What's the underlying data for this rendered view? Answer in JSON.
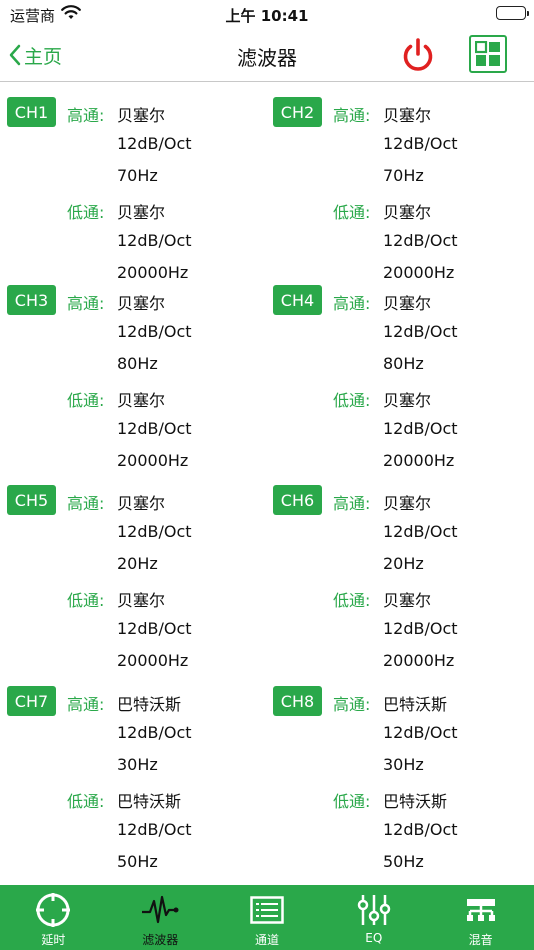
{
  "status": {
    "carrier": "运营商",
    "time": "上午 10:41"
  },
  "nav": {
    "back_label": "主页",
    "title": "滤波器"
  },
  "labels": {
    "high": "高通:",
    "low": "低通:"
  },
  "channels": [
    {
      "name": "CH1",
      "high": {
        "type": "贝塞尔",
        "slope": "12dB/Oct",
        "freq": "70Hz"
      },
      "low": {
        "type": "贝塞尔",
        "slope": "12dB/Oct",
        "freq": "20000Hz"
      }
    },
    {
      "name": "CH2",
      "high": {
        "type": "贝塞尔",
        "slope": "12dB/Oct",
        "freq": "70Hz"
      },
      "low": {
        "type": "贝塞尔",
        "slope": "12dB/Oct",
        "freq": "20000Hz"
      }
    },
    {
      "name": "CH3",
      "high": {
        "type": "贝塞尔",
        "slope": "12dB/Oct",
        "freq": "80Hz"
      },
      "low": {
        "type": "贝塞尔",
        "slope": "12dB/Oct",
        "freq": "20000Hz"
      }
    },
    {
      "name": "CH4",
      "high": {
        "type": "贝塞尔",
        "slope": "12dB/Oct",
        "freq": "80Hz"
      },
      "low": {
        "type": "贝塞尔",
        "slope": "12dB/Oct",
        "freq": "20000Hz"
      }
    },
    {
      "name": "CH5",
      "high": {
        "type": "贝塞尔",
        "slope": "12dB/Oct",
        "freq": "20Hz"
      },
      "low": {
        "type": "贝塞尔",
        "slope": "12dB/Oct",
        "freq": "20000Hz"
      }
    },
    {
      "name": "CH6",
      "high": {
        "type": "贝塞尔",
        "slope": "12dB/Oct",
        "freq": "20Hz"
      },
      "low": {
        "type": "贝塞尔",
        "slope": "12dB/Oct",
        "freq": "20000Hz"
      }
    },
    {
      "name": "CH7",
      "high": {
        "type": "巴特沃斯",
        "slope": "12dB/Oct",
        "freq": "30Hz"
      },
      "low": {
        "type": "巴特沃斯",
        "slope": "12dB/Oct",
        "freq": "50Hz"
      }
    },
    {
      "name": "CH8",
      "high": {
        "type": "巴特沃斯",
        "slope": "12dB/Oct",
        "freq": "30Hz"
      },
      "low": {
        "type": "巴特沃斯",
        "slope": "12dB/Oct",
        "freq": "50Hz"
      }
    }
  ],
  "tabs": [
    {
      "label": "延时",
      "icon": "crosshair-icon"
    },
    {
      "label": "滤波器",
      "icon": "waveform-icon",
      "selected": true
    },
    {
      "label": "通道",
      "icon": "list-icon"
    },
    {
      "label": "EQ",
      "icon": "sliders-icon"
    },
    {
      "label": "混音",
      "icon": "mixer-icon"
    }
  ],
  "colors": {
    "accent": "#2aa84a",
    "power": "#e02020"
  }
}
